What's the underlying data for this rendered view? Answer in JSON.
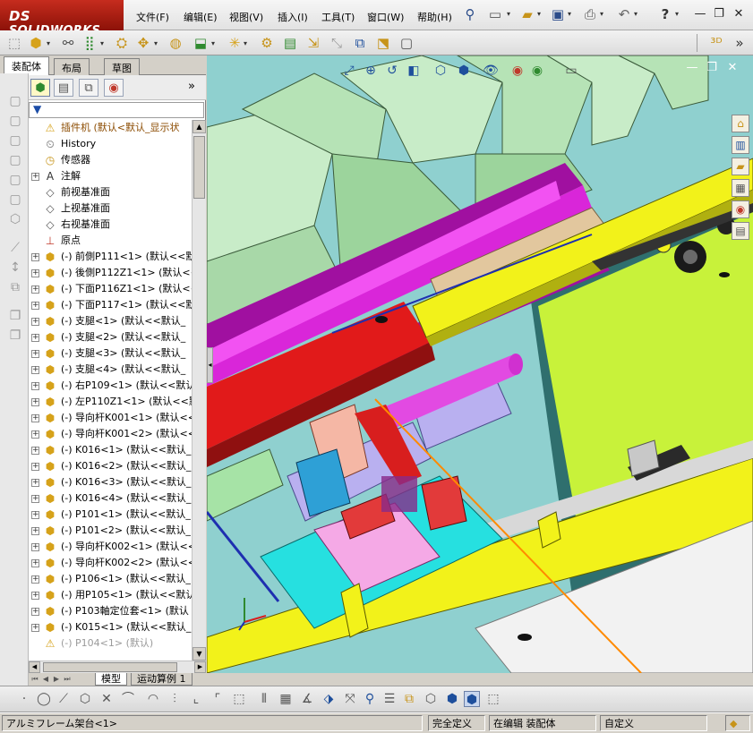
{
  "app": {
    "brand": "SOLIDWORKS",
    "brand_prefix": "DS"
  },
  "menu": {
    "items": [
      {
        "label": "文件(F)"
      },
      {
        "label": "编辑(E)"
      },
      {
        "label": "视图(V)"
      },
      {
        "label": "插入(I)"
      },
      {
        "label": "工具(T)"
      },
      {
        "label": "窗口(W)"
      },
      {
        "label": "帮助(H)"
      }
    ]
  },
  "quick_access": {
    "icons": [
      "pin-icon",
      "new-document-icon",
      "open-folder-icon",
      "save-icon",
      "print-icon",
      "undo-icon",
      "help-icon"
    ],
    "help_glyph": "?"
  },
  "window_controls": {
    "minimize": "—",
    "restore": "❐",
    "close": "✕"
  },
  "panel": {
    "tabs": [
      {
        "label": "装配体",
        "active": true
      },
      {
        "label": "布局",
        "active": false
      },
      {
        "label": "草图",
        "active": false
      }
    ],
    "manager_icons": [
      "feature-manager-icon",
      "property-manager-icon",
      "configuration-manager-icon",
      "display-manager-icon"
    ],
    "expand_glyph": "»",
    "filter_glyph": "▼"
  },
  "tree": {
    "items": [
      {
        "label": "插件机  (默认<默认_显示状",
        "icon": "assembly-warning-icon",
        "expander": "",
        "root": true,
        "suppressed": false
      },
      {
        "label": "History",
        "icon": "history-icon",
        "expander": "",
        "root": false,
        "suppressed": false
      },
      {
        "label": "传感器",
        "icon": "sensor-icon",
        "expander": "",
        "root": false,
        "suppressed": false
      },
      {
        "label": "注解",
        "icon": "annotation-icon",
        "expander": "+",
        "root": false,
        "suppressed": false
      },
      {
        "label": "前视基准面",
        "icon": "plane-icon",
        "expander": "",
        "root": false,
        "suppressed": false
      },
      {
        "label": "上视基准面",
        "icon": "plane-icon",
        "expander": "",
        "root": false,
        "suppressed": false
      },
      {
        "label": "右视基准面",
        "icon": "plane-icon",
        "expander": "",
        "root": false,
        "suppressed": false
      },
      {
        "label": "原点",
        "icon": "origin-icon",
        "expander": "",
        "root": false,
        "suppressed": false
      },
      {
        "label": "(-) 前側P111<1> (默认<<默",
        "icon": "part-icon",
        "expander": "+",
        "root": false,
        "suppressed": false
      },
      {
        "label": "(-) 後側P112Z1<1> (默认<<",
        "icon": "part-icon",
        "expander": "+",
        "root": false,
        "suppressed": false
      },
      {
        "label": "(-) 下面P116Z1<1> (默认<<",
        "icon": "part-icon",
        "expander": "+",
        "root": false,
        "suppressed": false
      },
      {
        "label": "(-) 下面P117<1> (默认<<默",
        "icon": "part-icon",
        "expander": "+",
        "root": false,
        "suppressed": false
      },
      {
        "label": "(-) 支腿<1> (默认<<默认_",
        "icon": "part-icon",
        "expander": "+",
        "root": false,
        "suppressed": false
      },
      {
        "label": "(-) 支腿<2> (默认<<默认_",
        "icon": "part-icon",
        "expander": "+",
        "root": false,
        "suppressed": false
      },
      {
        "label": "(-) 支腿<3> (默认<<默认_",
        "icon": "part-icon",
        "expander": "+",
        "root": false,
        "suppressed": false
      },
      {
        "label": "(-) 支腿<4> (默认<<默认_",
        "icon": "part-icon",
        "expander": "+",
        "root": false,
        "suppressed": false
      },
      {
        "label": "(-) 右P109<1> (默认<<默认",
        "icon": "part-icon",
        "expander": "+",
        "root": false,
        "suppressed": false
      },
      {
        "label": "(-) 左P110Z1<1> (默认<<默",
        "icon": "part-icon",
        "expander": "+",
        "root": false,
        "suppressed": false
      },
      {
        "label": "(-) 导向杆K001<1> (默认<<",
        "icon": "part-icon",
        "expander": "+",
        "root": false,
        "suppressed": false
      },
      {
        "label": "(-) 导向杆K001<2> (默认<<",
        "icon": "part-icon",
        "expander": "+",
        "root": false,
        "suppressed": false
      },
      {
        "label": "(-) K016<1> (默认<<默认_",
        "icon": "part-icon",
        "expander": "+",
        "root": false,
        "suppressed": false
      },
      {
        "label": "(-) K016<2> (默认<<默认_",
        "icon": "part-icon",
        "expander": "+",
        "root": false,
        "suppressed": false
      },
      {
        "label": "(-) K016<3> (默认<<默认_",
        "icon": "part-icon",
        "expander": "+",
        "root": false,
        "suppressed": false
      },
      {
        "label": "(-) K016<4> (默认<<默认_",
        "icon": "part-icon",
        "expander": "+",
        "root": false,
        "suppressed": false
      },
      {
        "label": "(-) P101<1> (默认<<默认_",
        "icon": "part-icon",
        "expander": "+",
        "root": false,
        "suppressed": false
      },
      {
        "label": "(-) P101<2> (默认<<默认_",
        "icon": "part-icon",
        "expander": "+",
        "root": false,
        "suppressed": false
      },
      {
        "label": "(-) 导向杆K002<1> (默认<<",
        "icon": "part-icon",
        "expander": "+",
        "root": false,
        "suppressed": false
      },
      {
        "label": "(-) 导向杆K002<2> (默认<<",
        "icon": "part-icon",
        "expander": "+",
        "root": false,
        "suppressed": false
      },
      {
        "label": "(-) P106<1> (默认<<默认_",
        "icon": "part-icon",
        "expander": "+",
        "root": false,
        "suppressed": false
      },
      {
        "label": "(-) 用P105<1> (默认<<默认",
        "icon": "part-icon",
        "expander": "+",
        "root": false,
        "suppressed": false
      },
      {
        "label": "(-) P103軸定位套<1> (默认",
        "icon": "part-icon",
        "expander": "+",
        "root": false,
        "suppressed": false
      },
      {
        "label": "(-) K015<1> (默认<<默认_",
        "icon": "part-icon",
        "expander": "+",
        "root": false,
        "suppressed": false
      },
      {
        "label": "(-) P104<1> (默认)",
        "icon": "suppressed-warning-icon",
        "expander": "",
        "root": false,
        "suppressed": true
      }
    ]
  },
  "model_tabs": [
    {
      "label": "模型",
      "active": true
    },
    {
      "label": "运动算例 1",
      "active": false
    }
  ],
  "status": {
    "component": "アルミフレーム架台<1>",
    "definition": "完全定义",
    "mode": "在编辑 装配体",
    "units": "自定义"
  },
  "colors": {
    "accent": "#1e4f9c",
    "brand_red": "#b3241a",
    "viewport_bg": "#8fd0cf"
  }
}
